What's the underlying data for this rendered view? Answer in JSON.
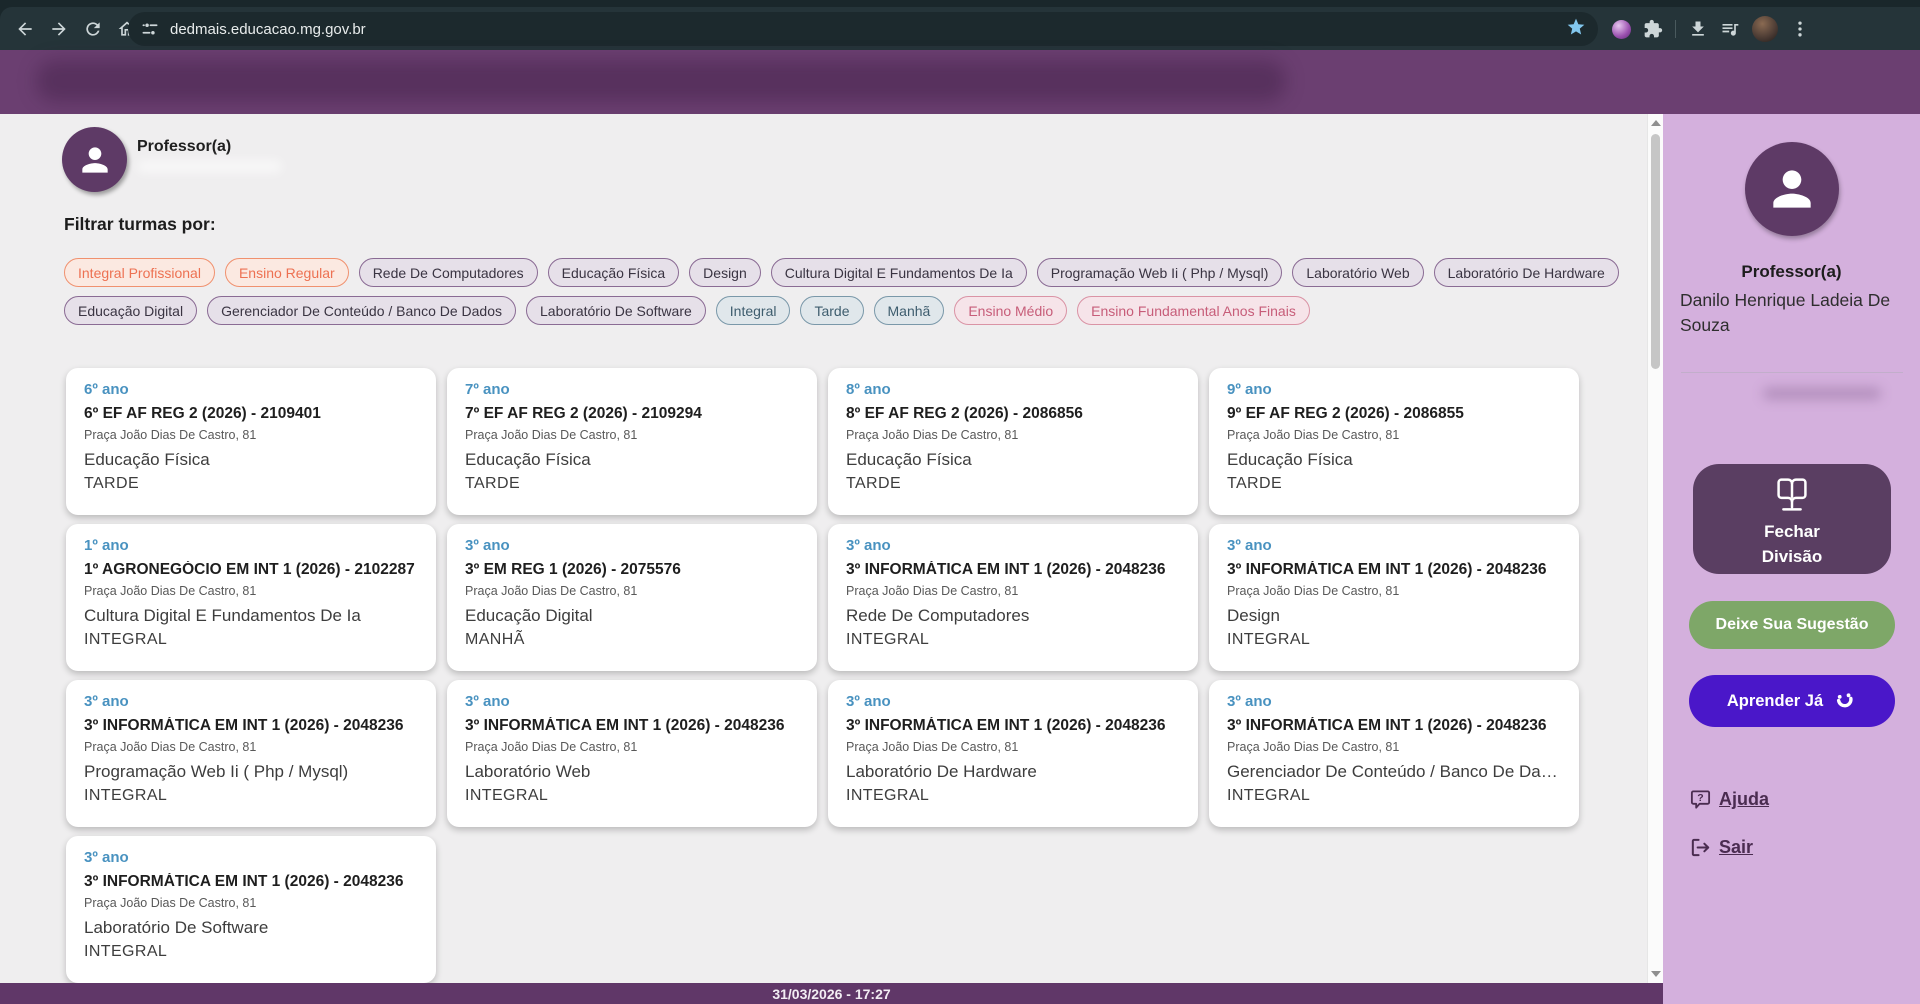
{
  "browser": {
    "url": "dedmais.educacao.mg.gov.br",
    "bookmark_star": "filled",
    "nav_icons": [
      "back-icon",
      "forward-icon",
      "reload-icon",
      "home-icon"
    ],
    "omnibox_icons": [
      "site-settings-icon",
      "bookmark-star-icon"
    ],
    "trailing_icons": [
      "extension-badge-icon",
      "extensions-puzzle-icon",
      "download-icon",
      "media-queue-icon",
      "profile-avatar",
      "kebab-menu-icon"
    ]
  },
  "profile": {
    "role": "Professor(a)",
    "avatar_icon": "person-icon"
  },
  "filters": {
    "title": "Filtrar turmas por:",
    "rows": [
      [
        {
          "label": "Integral Profissional",
          "style": "orange"
        },
        {
          "label": "Ensino Regular",
          "style": "orange"
        },
        {
          "label": "Rede De Computadores",
          "style": "purple"
        },
        {
          "label": "Educação Física",
          "style": "purple"
        },
        {
          "label": "Design",
          "style": "purple"
        },
        {
          "label": "Cultura Digital E Fundamentos De Ia",
          "style": "purple"
        },
        {
          "label": "Programação Web Ii ( Php / Mysql)",
          "style": "purple"
        },
        {
          "label": "Laboratório Web",
          "style": "purple"
        },
        {
          "label": "Laboratório De Hardware",
          "style": "purple"
        }
      ],
      [
        {
          "label": "Educação Digital",
          "style": "purple"
        },
        {
          "label": "Gerenciador De Conteúdo / Banco De Dados",
          "style": "purple"
        },
        {
          "label": "Laboratório De Software",
          "style": "purple"
        },
        {
          "label": "Integral",
          "style": "blue"
        },
        {
          "label": "Tarde",
          "style": "blue"
        },
        {
          "label": "Manhã",
          "style": "blue"
        },
        {
          "label": "Ensino Médio",
          "style": "pink"
        },
        {
          "label": "Ensino Fundamental Anos Finais",
          "style": "pink"
        }
      ]
    ]
  },
  "cards": [
    {
      "grade": "6º ano",
      "title": "6º EF AF REG 2 (2026) - 2109401",
      "address": "Praça João Dias De Castro, 81",
      "subject": "Educação Física",
      "shift": "TARDE"
    },
    {
      "grade": "7º ano",
      "title": "7º EF AF REG 2 (2026) - 2109294",
      "address": "Praça João Dias De Castro, 81",
      "subject": "Educação Física",
      "shift": "TARDE"
    },
    {
      "grade": "8º ano",
      "title": "8º EF AF REG 2 (2026) - 2086856",
      "address": "Praça João Dias De Castro, 81",
      "subject": "Educação Física",
      "shift": "TARDE"
    },
    {
      "grade": "9º ano",
      "title": "9º EF AF REG 2 (2026) - 2086855",
      "address": "Praça João Dias De Castro, 81",
      "subject": "Educação Física",
      "shift": "TARDE"
    },
    {
      "grade": "1º ano",
      "title": "1º AGRONEGÓCIO EM INT 1 (2026) - 2102287",
      "address": "Praça João Dias De Castro, 81",
      "subject": "Cultura Digital E Fundamentos De Ia",
      "shift": "INTEGRAL"
    },
    {
      "grade": "3º ano",
      "title": "3º EM REG 1 (2026) - 2075576",
      "address": "Praça João Dias De Castro, 81",
      "subject": "Educação Digital",
      "shift": "MANHÃ"
    },
    {
      "grade": "3º ano",
      "title": "3º INFORMÁTICA EM INT 1 (2026) - 2048236",
      "address": "Praça João Dias De Castro, 81",
      "subject": "Rede De Computadores",
      "shift": "INTEGRAL"
    },
    {
      "grade": "3º ano",
      "title": "3º INFORMÁTICA EM INT 1 (2026) - 2048236",
      "address": "Praça João Dias De Castro, 81",
      "subject": "Design",
      "shift": "INTEGRAL"
    },
    {
      "grade": "3º ano",
      "title": "3º INFORMÁTICA EM INT 1 (2026) - 2048236",
      "address": "Praça João Dias De Castro, 81",
      "subject": "Programação Web Ii ( Php / Mysql)",
      "shift": "INTEGRAL"
    },
    {
      "grade": "3º ano",
      "title": "3º INFORMÁTICA EM INT 1 (2026) - 2048236",
      "address": "Praça João Dias De Castro, 81",
      "subject": "Laboratório Web",
      "shift": "INTEGRAL"
    },
    {
      "grade": "3º ano",
      "title": "3º INFORMÁTICA EM INT 1 (2026) - 2048236",
      "address": "Praça João Dias De Castro, 81",
      "subject": "Laboratório De Hardware",
      "shift": "INTEGRAL"
    },
    {
      "grade": "3º ano",
      "title": "3º INFORMÁTICA EM INT 1 (2026) - 2048236",
      "address": "Praça João Dias De Castro, 81",
      "subject": "Gerenciador De Conteúdo / Banco De Da…",
      "shift": "INTEGRAL"
    },
    {
      "grade": "3º ano",
      "title": "3º INFORMÁTICA EM INT 1 (2026) - 2048236",
      "address": "Praça João Dias De Castro, 81",
      "subject": "Laboratório De Software",
      "shift": "INTEGRAL"
    }
  ],
  "sidebar": {
    "role": "Professor(a)",
    "name": "Danilo Henrique Ladeia De Souza",
    "avatar_icon": "person-icon",
    "close_division": {
      "line1": "Fechar",
      "line2": "Divisão",
      "icon": "open-book-monitor-icon"
    },
    "suggestion_label": "Deixe Sua Sugestão",
    "learn_label": "Aprender Já",
    "learn_icon": "smiley-icon",
    "help_label": "Ajuda",
    "help_icon": "question-bubble-icon",
    "logout_label": "Sair",
    "logout_icon": "logout-icon"
  },
  "footer": {
    "datetime": "31/03/2026 - 17:27"
  },
  "colors": {
    "browser_bar": "#253439",
    "browser_strip": "#1a272b",
    "omnibox": "#1c292d",
    "header_purple": "#6b3f71",
    "footer_purple": "#603768",
    "content_bg": "#efeeef",
    "sidebar_bg": "#d4b0dd",
    "avatar_purple": "#5e3a66",
    "grade_blue": "#4992c0",
    "card_bg": "#ffffff",
    "chip_orange_text": "#ed7152",
    "chip_orange_border": "#f0916f",
    "chip_orange_bg": "#fbe9e1",
    "chip_purple_text": "#3a3442",
    "chip_purple_border": "#8a6b94",
    "chip_purple_bg": "#e6e0e9",
    "chip_blue_text": "#3e5d6e",
    "chip_blue_border": "#7a98a9",
    "chip_blue_bg": "#e0e7eb",
    "chip_pink_text": "#c75d79",
    "chip_pink_border": "#da93a5",
    "chip_pink_bg": "#f6e4e9",
    "btn_dark_purple": "#5a3e62",
    "btn_green": "#7ea768",
    "btn_violet": "#4a17c9",
    "link_purple": "#4a2c50",
    "star_blue": "#82c7ee"
  }
}
